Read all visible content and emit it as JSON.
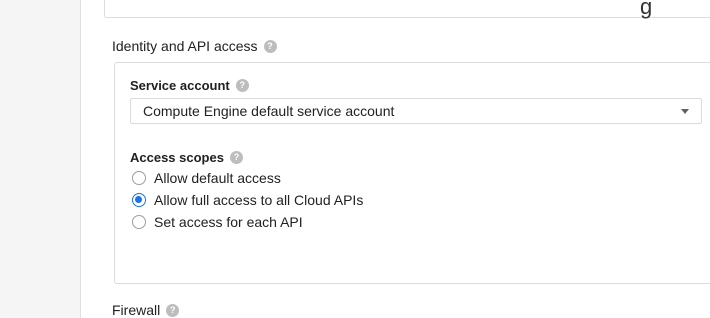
{
  "header_fragment": "g",
  "identity_section": {
    "title": "Identity and API access",
    "service_account": {
      "label": "Service account",
      "selected": "Compute Engine default service account"
    },
    "access_scopes": {
      "label": "Access scopes",
      "options": [
        {
          "label": "Allow default access",
          "checked": false
        },
        {
          "label": "Allow full access to all Cloud APIs",
          "checked": true
        },
        {
          "label": "Set access for each API",
          "checked": false
        }
      ]
    }
  },
  "firewall_section": {
    "title": "Firewall"
  },
  "colors": {
    "accent": "#1a73e8"
  }
}
